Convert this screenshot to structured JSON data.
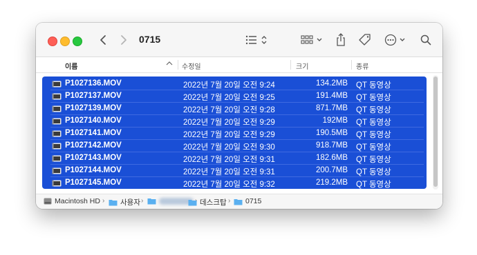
{
  "window": {
    "title": "0715"
  },
  "toolbar": {
    "back_icon": "chevron-left-icon",
    "forward_icon": "chevron-right-icon",
    "view_icon": "list-view-icon",
    "group_icon": "grid-group-icon",
    "share_icon": "share-icon",
    "tag_icon": "tag-icon",
    "more_icon": "ellipsis-circle-icon",
    "search_icon": "search-icon"
  },
  "columns": {
    "name": "이름",
    "date": "수정일",
    "size": "크기",
    "kind": "종류"
  },
  "files": [
    {
      "name": "P1027136.MOV",
      "date": "2022년 7월 20일 오전 9:24",
      "size": "134.2MB",
      "kind": "QT 동영상"
    },
    {
      "name": "P1027137.MOV",
      "date": "2022년 7월 20일 오전 9:25",
      "size": "191.4MB",
      "kind": "QT 동영상"
    },
    {
      "name": "P1027139.MOV",
      "date": "2022년 7월 20일 오전 9:28",
      "size": "871.7MB",
      "kind": "QT 동영상"
    },
    {
      "name": "P1027140.MOV",
      "date": "2022년 7월 20일 오전 9:29",
      "size": "192MB",
      "kind": "QT 동영상"
    },
    {
      "name": "P1027141.MOV",
      "date": "2022년 7월 20일 오전 9:29",
      "size": "190.5MB",
      "kind": "QT 동영상"
    },
    {
      "name": "P1027142.MOV",
      "date": "2022년 7월 20일 오전 9:30",
      "size": "918.7MB",
      "kind": "QT 동영상"
    },
    {
      "name": "P1027143.MOV",
      "date": "2022년 7월 20일 오전 9:31",
      "size": "182.6MB",
      "kind": "QT 동영상"
    },
    {
      "name": "P1027144.MOV",
      "date": "2022년 7월 20일 오전 9:31",
      "size": "200.7MB",
      "kind": "QT 동영상"
    },
    {
      "name": "P1027145.MOV",
      "date": "2022년 7월 20일 오전 9:32",
      "size": "219.2MB",
      "kind": "QT 동영상"
    }
  ],
  "pathbar": {
    "drive": "Macintosh HD",
    "users": "사용자",
    "desktop": "데스크탑",
    "folder": "0715"
  },
  "colors": {
    "selection": "#1a4fd6",
    "folder": "#5ab0f0"
  }
}
